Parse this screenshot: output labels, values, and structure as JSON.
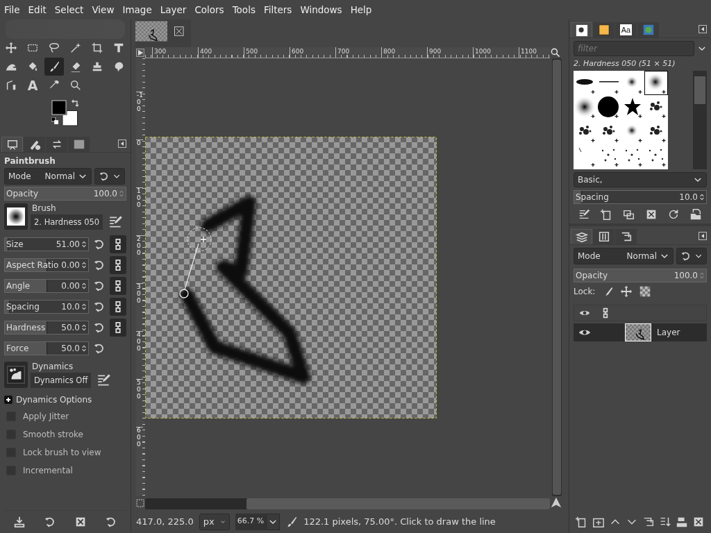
{
  "menu": [
    "File",
    "Edit",
    "Select",
    "View",
    "Image",
    "Layer",
    "Colors",
    "Tools",
    "Filters",
    "Windows",
    "Help"
  ],
  "tools": [
    {
      "kind": "move",
      "selected": false
    },
    {
      "kind": "rect-select",
      "selected": false
    },
    {
      "kind": "lasso",
      "selected": false
    },
    {
      "kind": "fuzzy-select",
      "selected": false
    },
    {
      "kind": "crop",
      "selected": false
    },
    {
      "kind": "transform",
      "selected": false
    },
    {
      "kind": "warp",
      "selected": false
    },
    {
      "kind": "bucket",
      "selected": false
    },
    {
      "kind": "paintbrush",
      "selected": true
    },
    {
      "kind": "eraser",
      "selected": false
    },
    {
      "kind": "clone",
      "selected": false
    },
    {
      "kind": "smudge",
      "selected": false
    },
    {
      "kind": "paths",
      "selected": false
    },
    {
      "kind": "text",
      "glyph": "A",
      "selected": false
    },
    {
      "kind": "color-picker",
      "selected": false
    },
    {
      "kind": "zoom",
      "selected": false
    }
  ],
  "dock_tabs": [
    {
      "kind": "tool-options",
      "selected": true
    },
    {
      "kind": "device-status",
      "selected": false
    },
    {
      "kind": "undo-history",
      "selected": false
    },
    {
      "kind": "images",
      "selected": false
    }
  ],
  "tool_options": {
    "title": "Paintbrush",
    "mode_label": "Mode",
    "mode": "Normal",
    "opacity": {
      "label": "Opacity",
      "value": "100.0",
      "level": 1
    },
    "brush_label": "Brush",
    "brush": "2. Hardness 050",
    "sliders": [
      {
        "label": "Size",
        "value": "51.00",
        "level": 0.03,
        "chain": true
      },
      {
        "label": "Aspect Ratio",
        "value": "0.00",
        "level": 0.5,
        "chain": true
      },
      {
        "label": "Angle",
        "value": "0.00",
        "level": 0.5,
        "chain": true
      },
      {
        "label": "Spacing",
        "value": "10.0",
        "level": 0.05,
        "chain": true
      },
      {
        "label": "Hardness",
        "value": "50.0",
        "level": 0.5,
        "chain": true
      },
      {
        "label": "Force",
        "value": "50.0",
        "level": 0.5,
        "chain": false
      }
    ],
    "dynamics_label": "Dynamics",
    "dynamics": "Dynamics Off",
    "dynamics_options": {
      "label": "Dynamics Options",
      "expanded": false
    },
    "checkboxes": [
      {
        "label": "Apply Jitter",
        "checked": false
      },
      {
        "label": "Smooth stroke",
        "checked": false
      },
      {
        "label": "Lock brush to view",
        "checked": false
      },
      {
        "label": "Incremental",
        "checked": false
      }
    ]
  },
  "rulers": {
    "horizontal": [
      "300",
      "400",
      "500",
      "600",
      "700",
      "800",
      "900",
      "1000",
      "1100"
    ],
    "vertical": [
      "-100",
      "0",
      "100",
      "200",
      "300",
      "400",
      "500",
      "600"
    ]
  },
  "status": {
    "coordinates": "417.0, 225.0",
    "unit": "px",
    "zoom": "66.7 %",
    "message": "122.1 pixels, 75.00°. Click to draw the line"
  },
  "brushes": {
    "dock_tabs": [
      {
        "kind": "brushes",
        "selected": true
      },
      {
        "kind": "patterns",
        "selected": false
      },
      {
        "kind": "fonts",
        "glyph": "Aa",
        "selected": false
      },
      {
        "kind": "gradients",
        "selected": false
      }
    ],
    "filter_placeholder": "filter",
    "selected_title": "2. Hardness 050 (51 × 51)",
    "items": [
      {
        "kind": "ellipse",
        "selected": false
      },
      {
        "kind": "line",
        "selected": false
      },
      {
        "kind": "soft-small",
        "selected": false
      },
      {
        "kind": "soft",
        "selected": true
      },
      {
        "kind": "soft-large",
        "selected": false
      },
      {
        "kind": "circle",
        "selected": false
      },
      {
        "kind": "star",
        "selected": false
      },
      {
        "kind": "splatter",
        "selected": false
      },
      {
        "kind": "splatter",
        "selected": false
      },
      {
        "kind": "splatter",
        "selected": false
      },
      {
        "kind": "soft-small",
        "selected": false
      },
      {
        "kind": "splatter",
        "selected": false
      },
      {
        "kind": "speck",
        "selected": false
      },
      {
        "kind": "dots",
        "selected": false
      },
      {
        "kind": "dots",
        "selected": false
      },
      {
        "kind": "dots",
        "selected": false
      }
    ],
    "tag": "Basic,",
    "spacing": {
      "label": "Spacing",
      "value": "10.0",
      "level": 0.05
    }
  },
  "layers": {
    "dock_tabs": [
      {
        "kind": "layers",
        "selected": true
      },
      {
        "kind": "channels",
        "selected": false
      },
      {
        "kind": "paths",
        "selected": false
      }
    ],
    "mode_label": "Mode",
    "mode": "Normal",
    "opacity": {
      "label": "Opacity",
      "value": "100.0",
      "level": 1
    },
    "lock_label": "Lock:",
    "items": [
      {
        "name": "Layer",
        "visible": true,
        "selected": true
      }
    ]
  }
}
